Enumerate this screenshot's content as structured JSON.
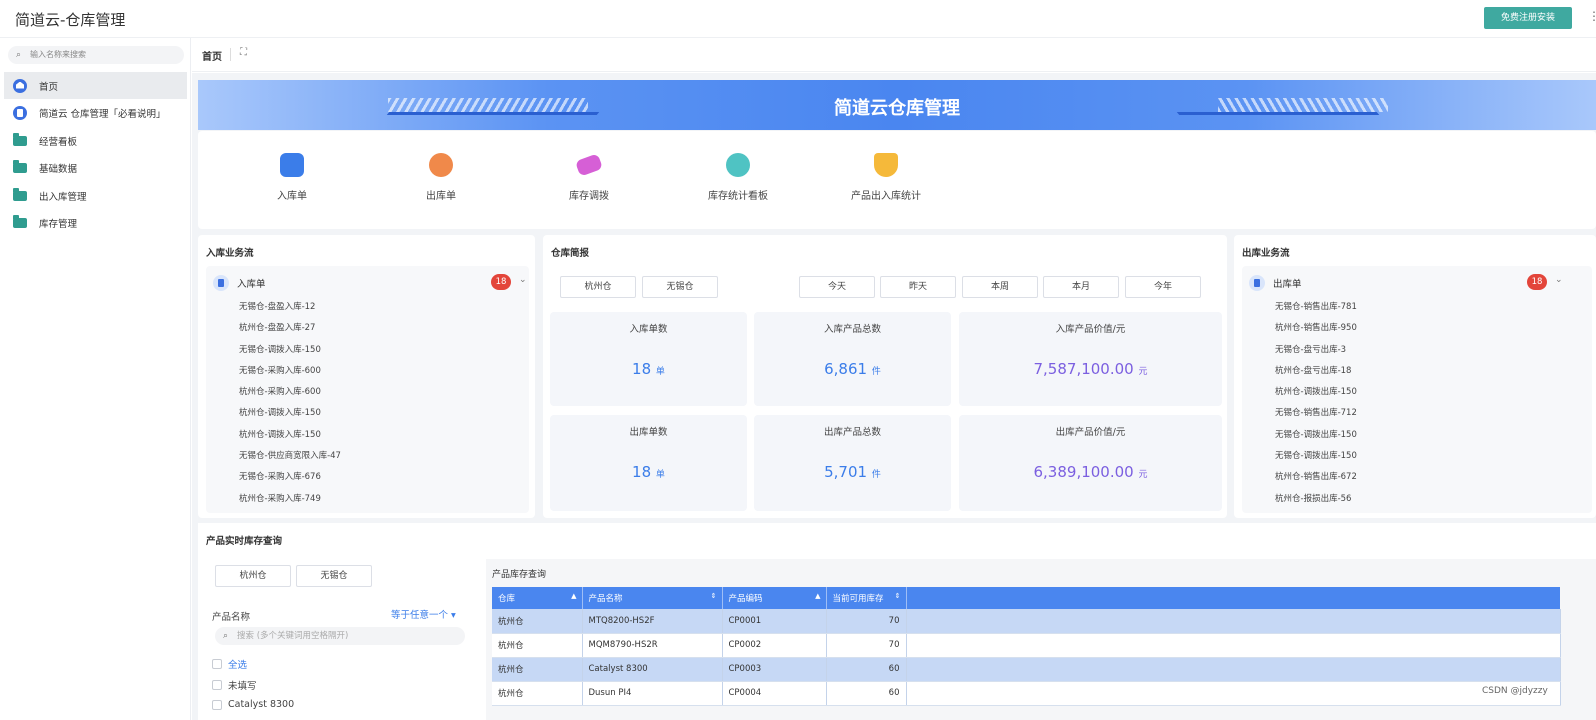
{
  "app": {
    "title": "简道云-仓库管理",
    "register_label": "免费注册安装",
    "more_label": "⋮"
  },
  "sidebar": {
    "search_placeholder": "输入名称来搜索",
    "items": [
      {
        "label": "首页",
        "icon": "home-icon"
      },
      {
        "label": "简道云 仓库管理「必看说明」",
        "icon": "doc-icon"
      },
      {
        "label": "经营看板",
        "icon": "folder-icon"
      },
      {
        "label": "基础数据",
        "icon": "folder-icon"
      },
      {
        "label": "出入库管理",
        "icon": "folder-icon"
      },
      {
        "label": "库存管理",
        "icon": "folder-icon"
      }
    ]
  },
  "tabs": {
    "home": "首页",
    "fullscreen_icon": "⛶"
  },
  "banner": {
    "title": "简道云仓库管理"
  },
  "quick": [
    {
      "label": "入库单",
      "color": "#3b7de9"
    },
    {
      "label": "出库单",
      "color": "#f0894a"
    },
    {
      "label": "库存调拨",
      "color": "#d65fd6"
    },
    {
      "label": "库存统计看板",
      "color": "#4fc3c3"
    },
    {
      "label": "产品出入库统计",
      "color": "#f5b93a"
    }
  ],
  "inbound": {
    "title": "入库业务流",
    "form": "入库单",
    "count": "18",
    "items": [
      "无锡仓-盘盈入库-12",
      "杭州仓-盘盈入库-27",
      "无锡仓-调拨入库-150",
      "无锡仓-采购入库-600",
      "杭州仓-采购入库-600",
      "杭州仓-调拨入库-150",
      "杭州仓-调拨入库-150",
      "无锡仓-供应商宽限入库-47",
      "无锡仓-采购入库-676",
      "杭州仓-采购入库-749"
    ]
  },
  "outbound": {
    "title": "出库业务流",
    "form": "出库单",
    "count": "18",
    "items": [
      "无锡仓-销售出库-781",
      "杭州仓-销售出库-950",
      "无锡仓-盘亏出库-3",
      "杭州仓-盘亏出库-18",
      "杭州仓-调拨出库-150",
      "无锡仓-销售出库-712",
      "无锡仓-调拨出库-150",
      "无锡仓-调拨出库-150",
      "杭州仓-销售出库-672",
      "杭州仓-报损出库-56"
    ]
  },
  "report": {
    "title": "仓库简报",
    "warehouses": [
      "杭州仓",
      "无锡仓"
    ],
    "periods": [
      "今天",
      "昨天",
      "本周",
      "本月",
      "今年"
    ],
    "stats": [
      {
        "label": "入库单数",
        "value": "18",
        "unit": "单"
      },
      {
        "label": "入库产品总数",
        "value": "6,861",
        "unit": "件"
      },
      {
        "label": "入库产品价值/元",
        "value": "7,587,100.00",
        "unit": "元"
      },
      {
        "label": "出库单数",
        "value": "18",
        "unit": "单"
      },
      {
        "label": "出库产品总数",
        "value": "5,701",
        "unit": "件"
      },
      {
        "label": "出库产品价值/元",
        "value": "6,389,100.00",
        "unit": "元"
      }
    ]
  },
  "inventory": {
    "title": "产品实时库存查询",
    "warehouses": [
      "杭州仓",
      "无锡仓"
    ],
    "filter_label": "产品名称",
    "filter_mode": "等于任意一个 ▾",
    "search_placeholder": "搜索 (多个关键词用空格隔开)",
    "options": [
      "全选",
      "未填写",
      "Catalyst 8300"
    ],
    "table_title": "产品库存查询",
    "columns": [
      "仓库",
      "产品名称",
      "产品编码",
      "当前可用库存"
    ],
    "rows": [
      [
        "杭州仓",
        "MTQ8200-HS2F",
        "CP0001",
        "70"
      ],
      [
        "杭州仓",
        "MQM8790-HS2R",
        "CP0002",
        "70"
      ],
      [
        "杭州仓",
        "Catalyst 8300",
        "CP0003",
        "60"
      ],
      [
        "杭州仓",
        "Dusun PI4",
        "CP0004",
        "60"
      ]
    ]
  },
  "watermark": "CSDN @jdyzzy"
}
